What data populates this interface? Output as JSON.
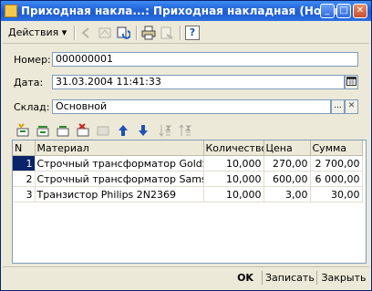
{
  "window": {
    "title": "Приходная накла...: Приходная накладная (Новый) *",
    "btn_minimize": "_",
    "btn_maximize": "□",
    "btn_close": "✕"
  },
  "toolbar": {
    "actions_label": "Действия",
    "actions_arrow": "▾",
    "help_label": "?"
  },
  "form": {
    "number_label": "Номер:",
    "number_value": "000000001",
    "date_label": "Дата:",
    "date_value": "31.03.2004 11:41:33",
    "warehouse_label": "Склад:",
    "warehouse_value": "Основной",
    "ellipsis": "...",
    "clear": "✕"
  },
  "table": {
    "headers": [
      "N",
      "Материал",
      "Количество",
      "Цена",
      "Сумма"
    ],
    "rows": [
      {
        "n": "1",
        "material": "Строчный трансформатор GoldStar",
        "qty": "10,000",
        "price": "270,00",
        "sum": "2 700,00"
      },
      {
        "n": "2",
        "material": "Строчный трансформатор Samsung",
        "qty": "10,000",
        "price": "600,00",
        "sum": "6 000,00"
      },
      {
        "n": "3",
        "material": "Транзистор Philips 2N2369",
        "qty": "10,000",
        "price": "3,00",
        "sum": "30,00"
      }
    ]
  },
  "bottom": {
    "ok_label": "OK",
    "save_label": "Записать",
    "close_label": "Закрыть"
  },
  "colors": {
    "titlebar": "#2466d8",
    "selection": "#0a246a"
  }
}
